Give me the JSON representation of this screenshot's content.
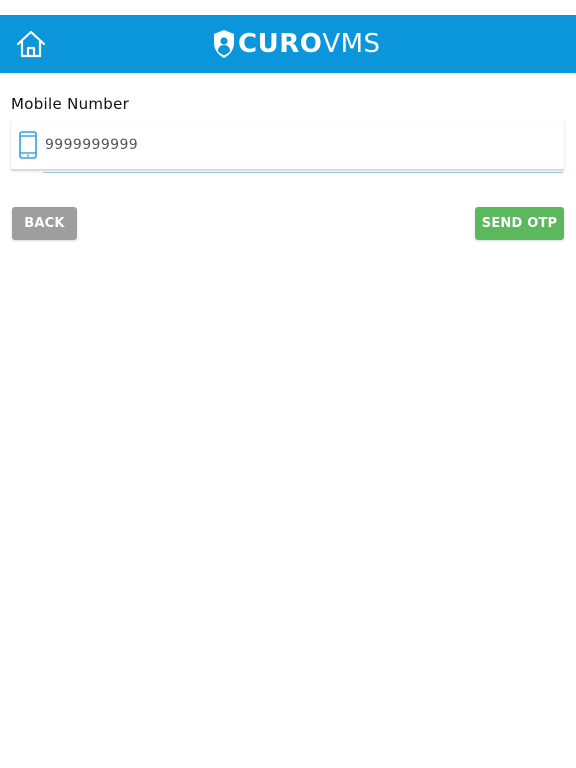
{
  "header": {
    "logo_bold": "CURO",
    "logo_light": "VMS",
    "home_icon": "home-icon",
    "background_color": "#0b95da"
  },
  "form": {
    "mobile_label": "Mobile Number",
    "mobile_value": "9999999999",
    "phone_icon": "smartphone-icon"
  },
  "actions": {
    "back_label": "BACK",
    "send_otp_label": "SEND OTP",
    "back_color": "#9e9e9e",
    "send_otp_color": "#5cb85c"
  }
}
